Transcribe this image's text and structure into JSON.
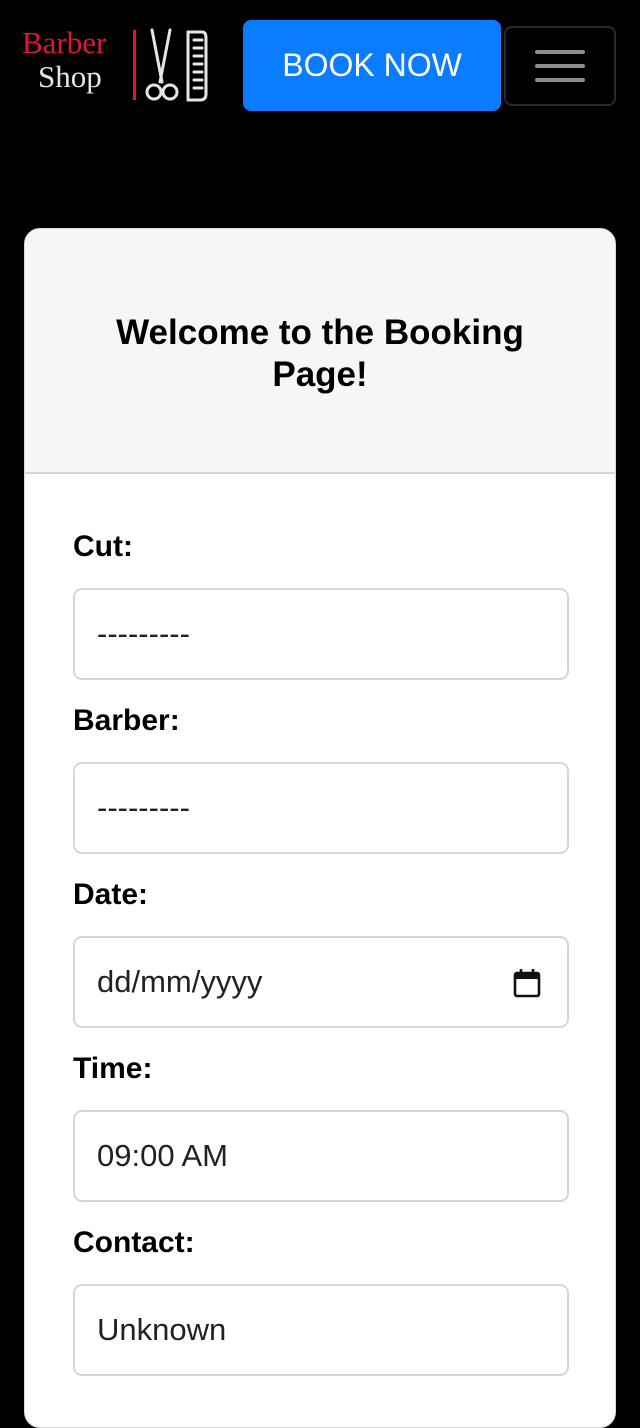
{
  "navbar": {
    "logo": {
      "line1": "Barber",
      "line2": "Shop",
      "icon": "scissors-comb-icon"
    },
    "book_button": "BOOK NOW",
    "menu_icon": "hamburger-menu-icon"
  },
  "colors": {
    "accent": "#0a7cff",
    "brand_red": "#e0143c",
    "background": "#000000"
  },
  "booking": {
    "title": "Welcome to the Booking Page!",
    "fields": [
      {
        "label": "Cut:",
        "value": "---------"
      },
      {
        "label": "Barber:",
        "value": "---------"
      },
      {
        "label": "Date:",
        "value": "dd/mm/yyyy",
        "icon": "calendar-icon"
      },
      {
        "label": "Time:",
        "value": "09:00 AM"
      },
      {
        "label": "Contact:",
        "value": "Unknown"
      }
    ]
  }
}
